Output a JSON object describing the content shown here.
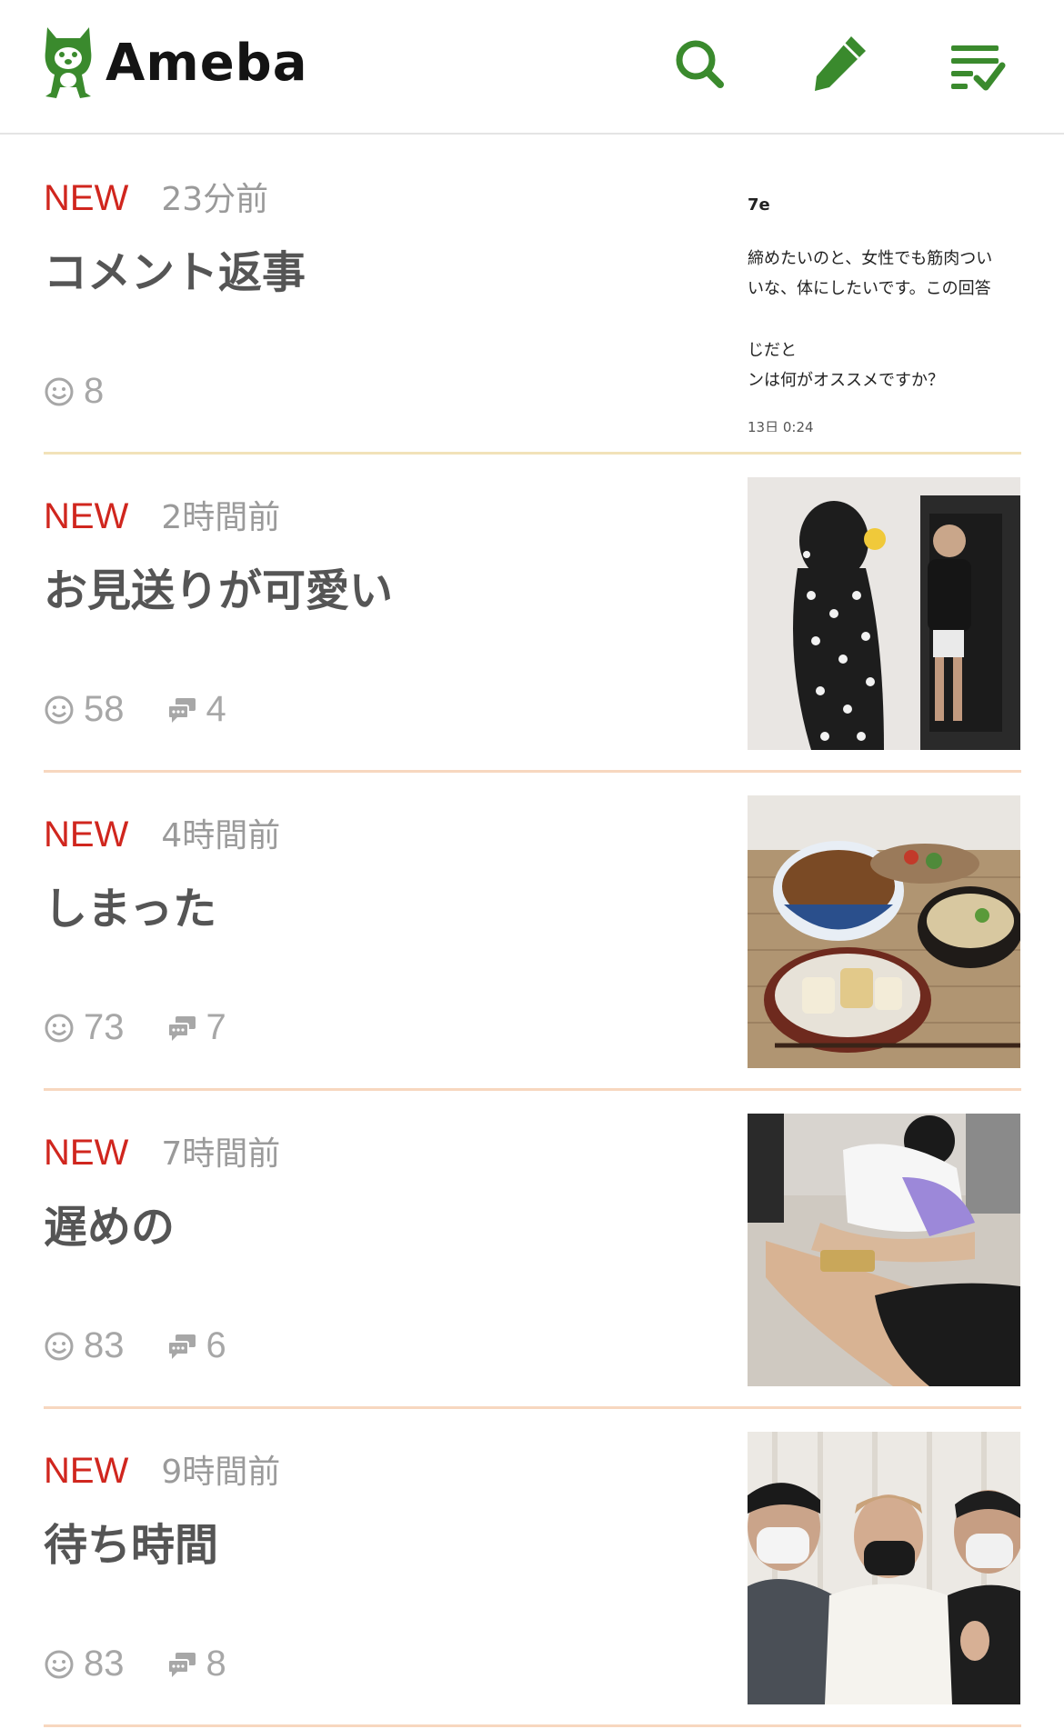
{
  "header": {
    "logo_text": "Ameba",
    "icons": [
      "search-icon",
      "pencil-icon",
      "checklist-icon"
    ],
    "accent_color": "#3a8a2d"
  },
  "entries": [
    {
      "badge": "NEW",
      "time": "23分前",
      "title": "コメント返事",
      "likes": "8",
      "comments": null,
      "thumb": {
        "type": "comment",
        "lines": [
          "7e",
          "締めたいのと、女性でも筋肉つい",
          "いな、体にしたいです。この回答",
          "じだと",
          "ンは何がオススメですか？",
          "13日 0:24"
        ]
      }
    },
    {
      "badge": "NEW",
      "time": "2時間前",
      "title": "お見送りが可愛い",
      "likes": "58",
      "comments": "4",
      "thumb": {
        "type": "photo"
      }
    },
    {
      "badge": "NEW",
      "time": "4時間前",
      "title": "しまった",
      "likes": "73",
      "comments": "7",
      "thumb": {
        "type": "photo"
      }
    },
    {
      "badge": "NEW",
      "time": "7時間前",
      "title": "遅めの",
      "likes": "83",
      "comments": "6",
      "thumb": {
        "type": "photo"
      }
    },
    {
      "badge": "NEW",
      "time": "9時間前",
      "title": "待ち時間",
      "likes": "83",
      "comments": "8",
      "thumb": {
        "type": "photo"
      }
    }
  ],
  "colors": {
    "new_badge": "#d0261e",
    "time": "#9a9a9a",
    "title": "#555555",
    "stats": "#a7a7a7",
    "divider": "#f7d7bf"
  }
}
